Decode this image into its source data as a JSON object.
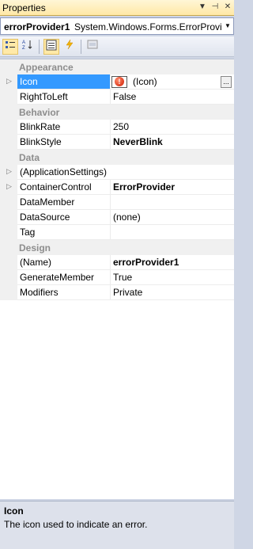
{
  "window": {
    "title": "Properties"
  },
  "object_selector": {
    "name": "errorProvider1",
    "type": "System.Windows.Forms.ErrorProvic"
  },
  "categories": {
    "appearance": "Appearance",
    "behavior": "Behavior",
    "data": "Data",
    "design": "Design"
  },
  "properties": {
    "icon": {
      "name": "Icon",
      "value": "(Icon)"
    },
    "right_to_left": {
      "name": "RightToLeft",
      "value": "False"
    },
    "blink_rate": {
      "name": "BlinkRate",
      "value": "250"
    },
    "blink_style": {
      "name": "BlinkStyle",
      "value": "NeverBlink"
    },
    "application_settings": {
      "name": "(ApplicationSettings)",
      "value": ""
    },
    "container_control": {
      "name": "ContainerControl",
      "value": "ErrorProvider"
    },
    "data_member": {
      "name": "DataMember",
      "value": ""
    },
    "data_source": {
      "name": "DataSource",
      "value": "(none)"
    },
    "tag": {
      "name": "Tag",
      "value": ""
    },
    "name": {
      "name": "(Name)",
      "value": "errorProvider1"
    },
    "generate_member": {
      "name": "GenerateMember",
      "value": "True"
    },
    "modifiers": {
      "name": "Modifiers",
      "value": "Private"
    }
  },
  "description": {
    "title": "Icon",
    "text": "The icon used to indicate an error."
  },
  "glyphs": {
    "ellipsis": "...",
    "error_mark": "!"
  },
  "colors": {
    "selection": "#3399ff",
    "title_bar": "#ffe8a6",
    "category_text": "#8d8d8d"
  }
}
